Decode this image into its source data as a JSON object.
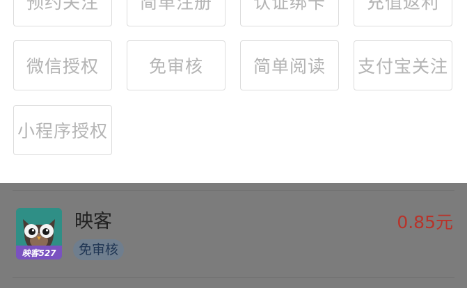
{
  "filters": {
    "options": [
      {
        "label": "预约关注"
      },
      {
        "label": "简单注册"
      },
      {
        "label": "认证绑卡"
      },
      {
        "label": "充值返利"
      },
      {
        "label": "微信授权"
      },
      {
        "label": "免审核"
      },
      {
        "label": "简单阅读"
      },
      {
        "label": "支付宝关注"
      },
      {
        "label": "小程序授权"
      }
    ]
  },
  "task_list": {
    "items": [
      {
        "app_name": "映客",
        "tag": "免审核",
        "price": "0.85元",
        "icon": "owl-app-icon",
        "icon_caption": "映客527"
      }
    ]
  },
  "colors": {
    "chip_text": "#b4b4b4",
    "chip_border": "#dcdcdc",
    "overlay": "#7c7c7c",
    "price": "#b8332a",
    "tag_text": "#1f3553"
  }
}
